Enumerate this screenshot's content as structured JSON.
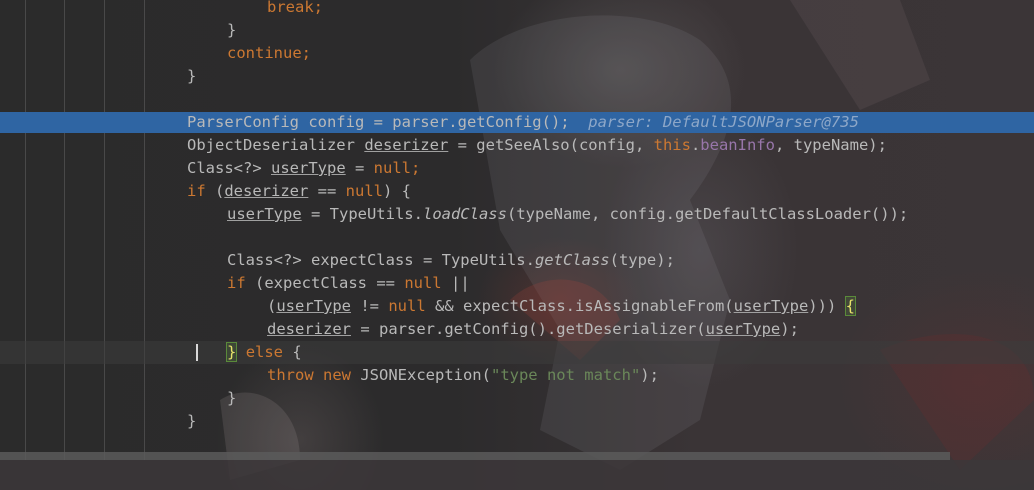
{
  "editor": {
    "lines": [
      {
        "id": "l0",
        "spans": [
          {
            "t": "break;",
            "c": "kw"
          }
        ]
      },
      {
        "id": "l1",
        "spans": [
          {
            "t": "}",
            "c": ""
          }
        ]
      },
      {
        "id": "l2",
        "spans": [
          {
            "t": "continue;",
            "c": "kw"
          }
        ]
      },
      {
        "id": "l3",
        "spans": [
          {
            "t": "}",
            "c": ""
          }
        ]
      },
      {
        "id": "l5",
        "spans": [
          {
            "t": "ParserConfig config = parser.getConfig();",
            "c": ""
          },
          {
            "t": "  parser: DefaultJSONParser@735",
            "c": "hint"
          }
        ]
      },
      {
        "id": "l6",
        "spans": [
          {
            "t": "ObjectDeserializer ",
            "c": ""
          },
          {
            "t": "deserizer",
            "c": "ul"
          },
          {
            "t": " = getSeeAlso(config, ",
            "c": ""
          },
          {
            "t": "this",
            "c": "kw"
          },
          {
            "t": ".",
            "c": ""
          },
          {
            "t": "beanInfo",
            "c": "fld"
          },
          {
            "t": ", typeName);",
            "c": ""
          }
        ]
      },
      {
        "id": "l7",
        "spans": [
          {
            "t": "Class<?> ",
            "c": ""
          },
          {
            "t": "userType",
            "c": "ul"
          },
          {
            "t": " = ",
            "c": ""
          },
          {
            "t": "null;",
            "c": "kw"
          }
        ]
      },
      {
        "id": "l8",
        "spans": [
          {
            "t": "if ",
            "c": "kw"
          },
          {
            "t": "(",
            "c": ""
          },
          {
            "t": "deserizer",
            "c": "ul"
          },
          {
            "t": " == ",
            "c": ""
          },
          {
            "t": "null",
            "c": "kw"
          },
          {
            "t": ") {",
            "c": ""
          }
        ]
      },
      {
        "id": "l9",
        "spans": [
          {
            "t": "userType",
            "c": "ul"
          },
          {
            "t": " = TypeUtils.",
            "c": ""
          },
          {
            "t": "loadClass",
            "c": "it"
          },
          {
            "t": "(typeName, config.getDefaultClassLoader());",
            "c": ""
          }
        ]
      },
      {
        "id": "l11",
        "spans": [
          {
            "t": "Class<?> expectClass = TypeUtils.",
            "c": ""
          },
          {
            "t": "getClass",
            "c": "it"
          },
          {
            "t": "(type);",
            "c": ""
          }
        ]
      },
      {
        "id": "l12",
        "spans": [
          {
            "t": "if ",
            "c": "kw"
          },
          {
            "t": "(expectClass == ",
            "c": ""
          },
          {
            "t": "null ",
            "c": "kw"
          },
          {
            "t": "||",
            "c": ""
          }
        ]
      },
      {
        "id": "l13",
        "spans": [
          {
            "t": "(",
            "c": ""
          },
          {
            "t": "userType",
            "c": "ul"
          },
          {
            "t": " != ",
            "c": ""
          },
          {
            "t": "null ",
            "c": "kw"
          },
          {
            "t": "&& expectClass.isAssignableFrom(",
            "c": ""
          },
          {
            "t": "userType",
            "c": "ul"
          },
          {
            "t": "))) ",
            "c": ""
          },
          {
            "t": "{",
            "c": "brace-y brace-box"
          }
        ]
      },
      {
        "id": "l14",
        "spans": [
          {
            "t": "deserizer",
            "c": "ul"
          },
          {
            "t": " = parser.getConfig().getDeserializer(",
            "c": ""
          },
          {
            "t": "userType",
            "c": "ul"
          },
          {
            "t": ");",
            "c": ""
          }
        ]
      },
      {
        "id": "l15",
        "spans": [
          {
            "t": "}",
            "c": "brace-y brace-box"
          },
          {
            "t": " ",
            "c": ""
          },
          {
            "t": "else ",
            "c": "kw"
          },
          {
            "t": "{",
            "c": ""
          }
        ]
      },
      {
        "id": "l16",
        "spans": [
          {
            "t": "throw new ",
            "c": "kw"
          },
          {
            "t": "JSONException(",
            "c": ""
          },
          {
            "t": "\"type not match\"",
            "c": "str"
          },
          {
            "t": ");",
            "c": ""
          }
        ]
      },
      {
        "id": "l17",
        "spans": [
          {
            "t": "}",
            "c": ""
          }
        ]
      },
      {
        "id": "l18",
        "spans": [
          {
            "t": "}",
            "c": ""
          }
        ]
      }
    ]
  },
  "colors": {
    "background": "#2b2b2b",
    "selection": "#2f65a3",
    "keyword": "#cc7832",
    "field": "#9876aa",
    "string": "#6a8759",
    "inline_hint": "#8da7c8",
    "text": "#b9b9b9"
  },
  "icons": {
    "caret": "text-cursor-icon"
  }
}
